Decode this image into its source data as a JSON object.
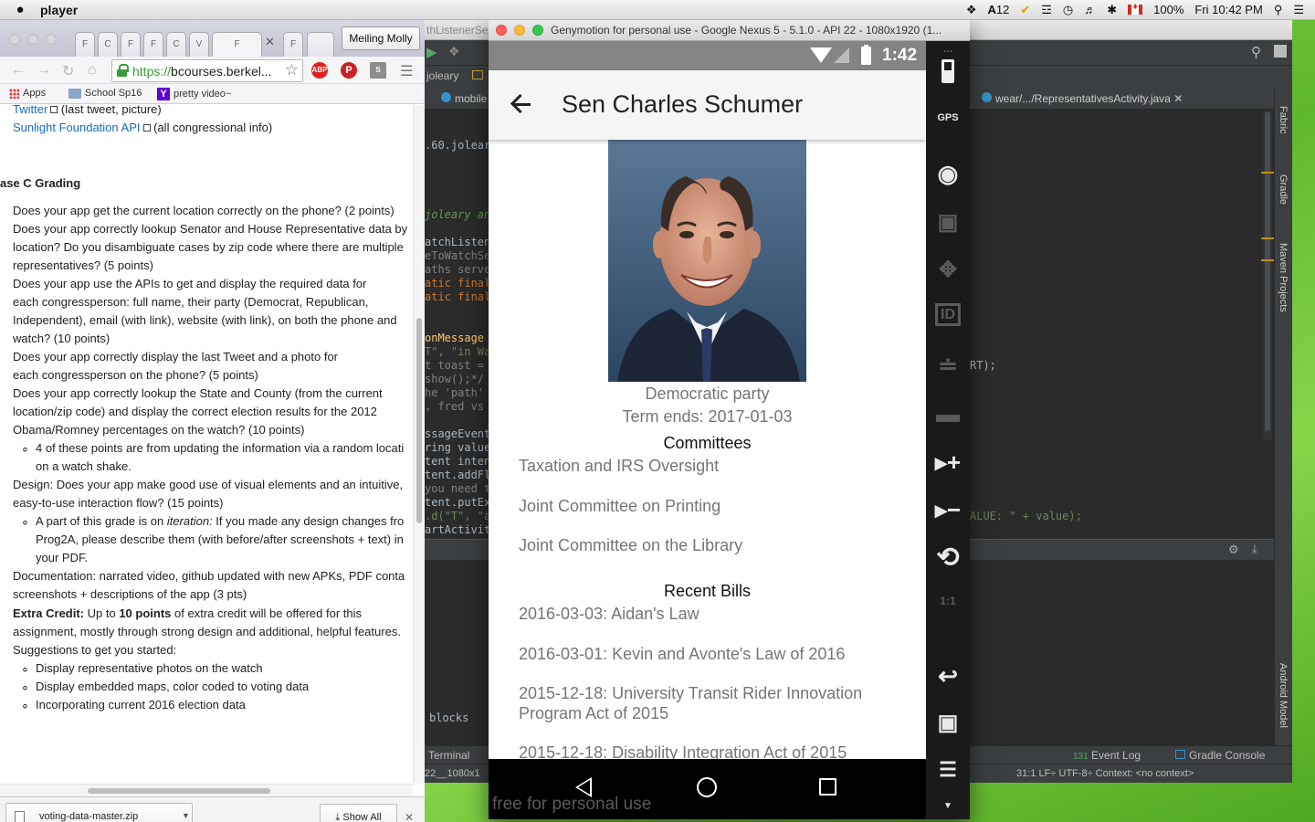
{
  "menubar": {
    "app_name": "player",
    "ime": "A",
    "ime_number": "12",
    "battery": "100%",
    "clock": "Fri 10:42 PM"
  },
  "chrome": {
    "tabs": [
      "F",
      "C",
      "F",
      "F",
      "C",
      "V",
      "F",
      "F"
    ],
    "profile": "Meiling Molly",
    "url_scheme": "https://",
    "url_host": "bcourses.berkel...",
    "extensions": [
      "ABP",
      "P",
      "S"
    ],
    "bookmarks": [
      "Apps",
      "School Sp16",
      "pretty video~"
    ],
    "page": {
      "twitter_link": "Twitter",
      "twitter_desc": "(last tweet, picture)",
      "sunlight_link": "Sunlight Foundation API",
      "sunlight_desc": "(all congressional info)",
      "heading": "ase C Grading",
      "lines": [
        "Does your app get the current location correctly on the phone? (2 points)",
        "Does your app correctly lookup Senator and House Representative data by",
        "location? Do you disambiguate cases by zip code where there are multiple",
        "representatives? (5 points)",
        "Does your app use the APIs to get and display the required data for",
        "each congressperson: full name, their party (Democrat, Republican,",
        "Independent), email (with link), website (with link), on both the phone and",
        "watch? (10 points)",
        "Does your app correctly display the last Tweet and a photo for",
        "each congressperson on the phone? (5 points)",
        "Does your app correctly lookup the State and County (from the current",
        "location/zip code) and display the correct election results for the 2012",
        "Obama/Romney percentages on the watch? (10 points)"
      ],
      "sub1a": "4 of these points are from updating the information via a random locati",
      "sub1b": "on a watch shake.",
      "design1": "Design: Does your app make good use of visual elements and an intuitive,",
      "design2": "easy-to-use interaction flow? (15 points)",
      "iter_pre": "A part of this grade is on ",
      "iter_em": "iteration:",
      "iter_post": " If you made any design changes fro",
      "iter2": "Prog2A, please describe them (with before/after screenshots + text) in",
      "iter3": "your PDF.",
      "doc1": "Documentation: narrated video, github updated with new APKs, PDF conta",
      "doc2": "screenshots + descriptions of the app (3 pts)",
      "extra_label": "Extra Credit:",
      "extra_mid": " Up to ",
      "extra_points": "10 points",
      "extra_post": " of extra credit will be offered for this",
      "extra2": "assignment, mostly through strong design and additional, helpful features.",
      "extra3": "Suggestions to get you started:",
      "suggestions": [
        "Display representative photos on the watch",
        "Display embedded maps, color coded to voting data",
        "Incorporating current 2016 election data"
      ]
    },
    "download": {
      "file": "voting-data-master.zip",
      "show_all": "Show All"
    }
  },
  "studio": {
    "title_fragment": "thListenerSe",
    "breadcrumb": "joleary",
    "tab_left": "mobile",
    "tab_right": "wear/.../RepresentativesActivity.java",
    "code_lines": [
      ".60.joleary",
      "joleary and",
      "atchListene",
      "eToWatchSer",
      "aths serve",
      "atic final",
      "atic final",
      "onMessage",
      "T\", \"in Wa",
      "t toast = T",
      "show();*/",
      "he 'path'",
      ", fred vs",
      "ssageEvent.",
      "ring value",
      "tent intent",
      "tent.addFla",
      "you need to",
      "tent.putExt",
      ".d(\"T\", \"a",
      "artActivity"
    ],
    "code_right1": "RT);",
    "code_right2": "ALUE: \" + value);",
    "blocks_label": "blocks",
    "terminal_label": "Terminal",
    "event_log": "Event Log",
    "event_count": "131",
    "gradle_console": "Gradle Console",
    "status_left": "22__1080x1",
    "status_right": "31:1  LF÷  UTF-8÷  Context: <no context>",
    "side_labels": [
      "Fabric",
      "Gradle",
      "Maven Projects",
      "Android Model"
    ]
  },
  "genymotion": {
    "title": "Genymotion for personal use - Google Nexus 5 - 5.1.0 - API 22 - 1080x1920 (1...",
    "status_time": "1:42",
    "app_title": "Sen Charles Schumer",
    "party": "Democratic party",
    "term": "Term ends: 2017-01-03",
    "committees_heading": "Committees",
    "committees": [
      "Taxation and IRS Oversight",
      "Joint Committee on Printing",
      "Joint Committee on the Library"
    ],
    "bills_heading": "Recent Bills",
    "bills": [
      "2016-03-03: Aidan's Law",
      "2016-03-01: Kevin and Avonte's Law of 2016",
      "2015-12-18: University Transit Rider Innovation",
      "Program Act of 2015",
      "2015-12-18: Disability Integration Act of 2015"
    ],
    "watermark": "free for personal use",
    "side_buttons": [
      "battery",
      "GPS",
      "webcam",
      "capture",
      "dpad",
      "ID",
      "rss",
      "sms",
      "vol+",
      "vol-",
      "rotate",
      "1:1",
      "back",
      "recent",
      "menu",
      "more"
    ]
  }
}
